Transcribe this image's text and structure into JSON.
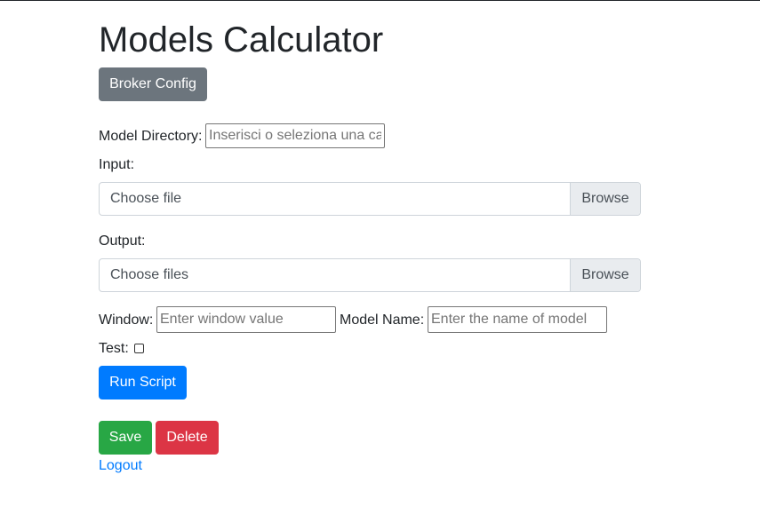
{
  "page": {
    "title": "Models Calculator"
  },
  "buttons": {
    "broker_config": "Broker Config",
    "run_script": "Run Script",
    "save": "Save",
    "delete": "Delete"
  },
  "form": {
    "model_directory": {
      "label": "Model Directory:",
      "placeholder": "Inserisci o seleziona una cartella",
      "value": ""
    },
    "input": {
      "label": "Input:",
      "file_text": "Choose file",
      "browse": "Browse"
    },
    "output": {
      "label": "Output:",
      "file_text": "Choose files",
      "browse": "Browse"
    },
    "window": {
      "label": "Window:",
      "placeholder": "Enter window value",
      "value": ""
    },
    "model_name": {
      "label": "Model Name:",
      "placeholder": "Enter the name of model",
      "value": ""
    },
    "test": {
      "label": "Test:",
      "checked": false
    }
  },
  "links": {
    "logout": "Logout"
  },
  "colors": {
    "primary": "#007bff",
    "secondary": "#6c757d",
    "success": "#28a745",
    "danger": "#dc3545"
  }
}
